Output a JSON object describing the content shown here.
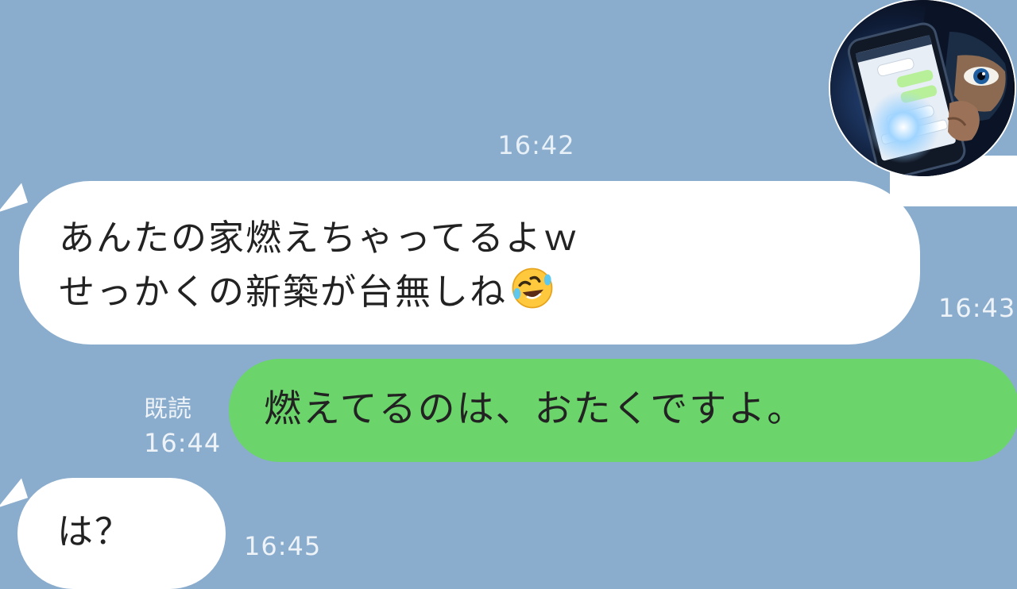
{
  "chat": {
    "divider_time": "16:42",
    "messages": [
      {
        "side": "incoming",
        "lines": [
          "あんたの家燃えちゃってるよｗ",
          "せっかくの新築が台無しね"
        ],
        "emoji": "rolling-on-floor-laughing-emoji",
        "time": "16:43"
      },
      {
        "side": "outgoing",
        "text": "燃えてるのは、おたくですよ。",
        "read_status": "既読",
        "time": "16:44"
      },
      {
        "side": "incoming",
        "text": "は？",
        "time": "16:45"
      }
    ]
  },
  "colors": {
    "background": "#8aaccd",
    "incoming_bubble": "#ffffff",
    "outgoing_bubble": "#6bd56b",
    "timestamp": "#eef3f8"
  },
  "thumbnail": {
    "description_icon": "hooded-figure-holding-phone-icon"
  }
}
